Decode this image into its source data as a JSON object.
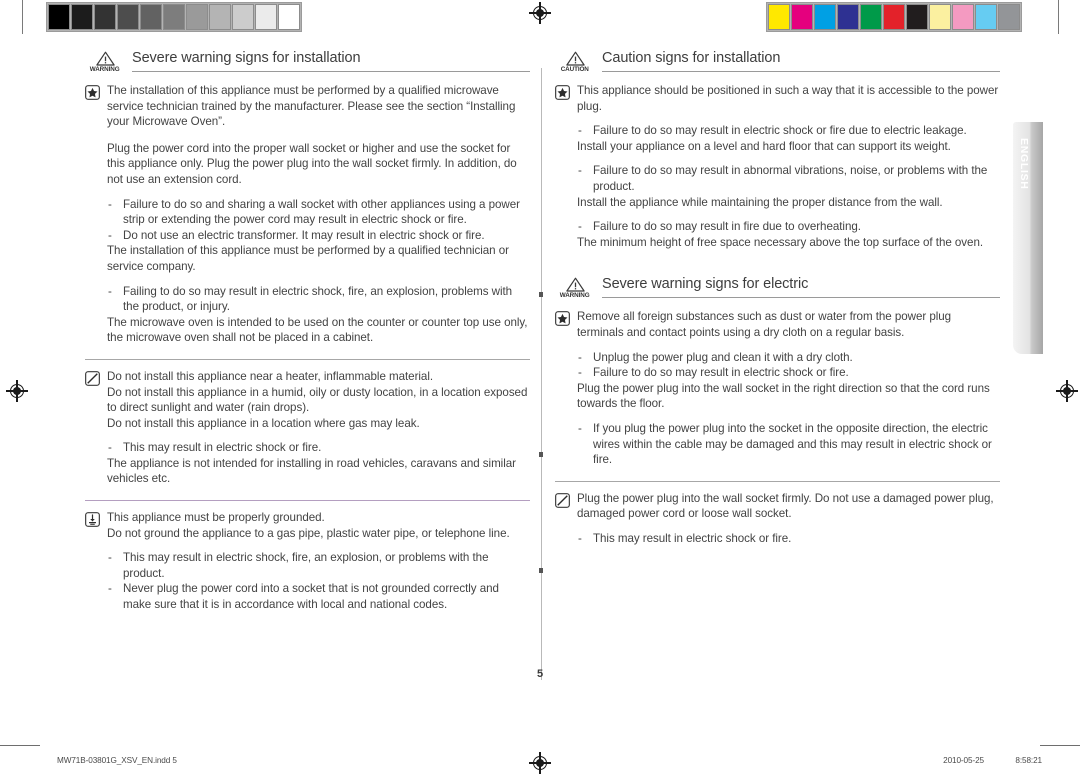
{
  "document": {
    "page_number": "5",
    "language_tab": "ENGLISH"
  },
  "print_marks": {
    "gray_scale_swatches": [
      "#000000",
      "#1c1c1c",
      "#333333",
      "#4d4d4d",
      "#626262",
      "#7d7d7d",
      "#9a9a9a",
      "#b4b4b4",
      "#cccccc",
      "#ebebeb",
      "#ffffff"
    ],
    "color_swatches": [
      "#ffe800",
      "#e5007e",
      "#00a0e4",
      "#2e3192",
      "#009a49",
      "#e3222a",
      "#211d1e",
      "#fbf0a0",
      "#f49ac1",
      "#66ccf2",
      "#939598"
    ],
    "registration_icon": "registration-target-icon"
  },
  "left_column": {
    "heading": {
      "mark_word": "WARNING",
      "mark_icon": "warning-triangle-icon",
      "title": "Severe warning signs for installation"
    },
    "blocks": [
      {
        "icon": "star-badge-icon",
        "paragraphs": [
          "The installation of this appliance must be performed by a qualified microwave service technician trained by the manufacturer. Please see the section “Installing your Microwave Oven”.",
          "Plug the power cord into the proper wall socket or higher and use the socket for this appliance only. Plug the power plug into the wall socket firmly. In addition, do not use an extension cord."
        ],
        "bullets": [
          "Failure to do so and sharing a wall socket with other appliances using a power strip or extending the power cord may result in electric shock or fire.",
          "Do not use an electric transformer. It may result in electric shock or fire."
        ],
        "paragraphs_after": [
          "The installation of this appliance must be performed by a qualified technician or service company."
        ],
        "bullets_after": [
          "Failing to do so may result in electric shock, fire, an explosion, problems with the product, or injury."
        ],
        "paragraphs_last": [
          "The microwave oven is intended to be used on the counter or counter top use only, the microwave oven shall not be placed in a cabinet."
        ]
      },
      {
        "icon": "prohibition-slash-icon",
        "paragraphs": [
          "Do not install this appliance near a heater, inflammable material.",
          "Do not install this appliance in a humid, oily or dusty location, in a location exposed to direct sunlight and water (rain drops).",
          "Do not install this appliance in a location where gas may leak."
        ],
        "bullets": [
          "This may result in electric shock or fire."
        ],
        "paragraphs_after": [
          "The appliance is not intended for installing in road vehicles, caravans and similar vehicles etc."
        ]
      },
      {
        "icon": "ground-earth-icon",
        "paragraphs": [
          "This appliance must be properly grounded.",
          "Do not ground the appliance to a gas pipe, plastic water pipe, or telephone line."
        ],
        "bullets": [
          "This may result in electric shock, fire, an explosion, or problems with the product.",
          "Never plug the power cord into a socket that is not grounded correctly and make sure that it is in accordance with local and national codes."
        ]
      }
    ]
  },
  "right_column": {
    "heading_caution": {
      "mark_word": "CAUTION",
      "mark_icon": "warning-triangle-icon",
      "title": "Caution signs for installation"
    },
    "caution_block": {
      "icon": "star-badge-icon",
      "paragraph_1": "This appliance should be positioned in such a way that it is accessible to the power plug.",
      "bullet_1": "Failure to do so may result in electric shock or fire due to electric leakage.",
      "paragraph_2": "Install your appliance on a level and hard floor that can support its weight.",
      "bullet_2": "Failure to do so may result in abnormal vibrations, noise, or problems with the product.",
      "paragraph_3": "Install the appliance while maintaining the proper distance from the wall.",
      "bullet_3": "Failure to do so may result in fire due to overheating.",
      "paragraph_4": "The minimum height of free space necessary above the top surface of the oven."
    },
    "heading_warning": {
      "mark_word": "WARNING",
      "mark_icon": "warning-triangle-icon",
      "title": "Severe warning signs for electric"
    },
    "warning_block": {
      "icon": "star-badge-icon",
      "paragraph_1": "Remove all foreign substances such as dust or water from the power plug terminals and contact points using a dry cloth on a regular basis.",
      "bullet_1": "Unplug the power plug and clean it with a dry cloth.",
      "bullet_2": "Failure to do so may result in electric shock or fire.",
      "paragraph_2": "Plug the power plug into the wall socket in the right direction so that the cord runs towards the floor.",
      "bullet_3": "If you plug the power plug into the socket in the opposite direction, the electric wires within the cable may be damaged and this may result in electric shock or fire."
    },
    "prohibition_block": {
      "icon": "prohibition-slash-icon",
      "paragraph_1": "Plug the power plug into the wall socket firmly. Do not use a damaged power plug, damaged power cord or loose wall socket.",
      "bullet_1": "This may result in electric shock or fire."
    }
  },
  "footer": {
    "file_name": "MW71B-03801G_XSV_EN.indd   5",
    "date": "2010-05-25",
    "time": "8:58:21"
  },
  "symbols": {
    "dash": "-"
  }
}
